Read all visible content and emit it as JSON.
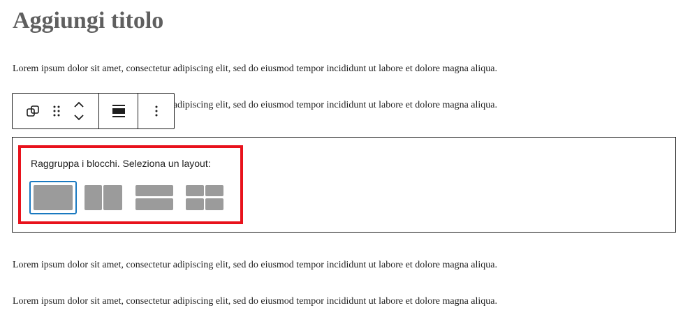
{
  "title": "Aggiungi titolo",
  "paragraphs": {
    "p1": "Lorem ipsum dolor sit amet, consectetur adipiscing elit, sed do eiusmod tempor incididunt ut labore et dolore magna aliqua.",
    "p2": "Lorem ipsum dolor sit amet, consectetur adipiscing elit, sed do eiusmod tempor incididunt ut labore et dolore magna aliqua.",
    "p3": "Lorem ipsum dolor sit amet, consectetur adipiscing elit, sed do eiusmod tempor incididunt ut labore et dolore magna aliqua.",
    "p4": "Lorem ipsum dolor sit amet, consectetur adipiscing elit, sed do eiusmod tempor incididunt ut labore et dolore magna aliqua."
  },
  "toolbar": {
    "buttons": [
      "block-type-icon",
      "drag-handle-icon",
      "move-up-down-icon",
      "align-icon",
      "more-options-icon"
    ]
  },
  "group_placeholder": {
    "instruction": "Raggruppa i blocchi. Seleziona un layout:",
    "layouts": [
      "group",
      "row",
      "stack",
      "grid"
    ],
    "selected_layout": "group"
  },
  "colors": {
    "highlight": "#e8121c",
    "selected": "#1a79c0",
    "layout_fill": "#9b9b9b"
  }
}
